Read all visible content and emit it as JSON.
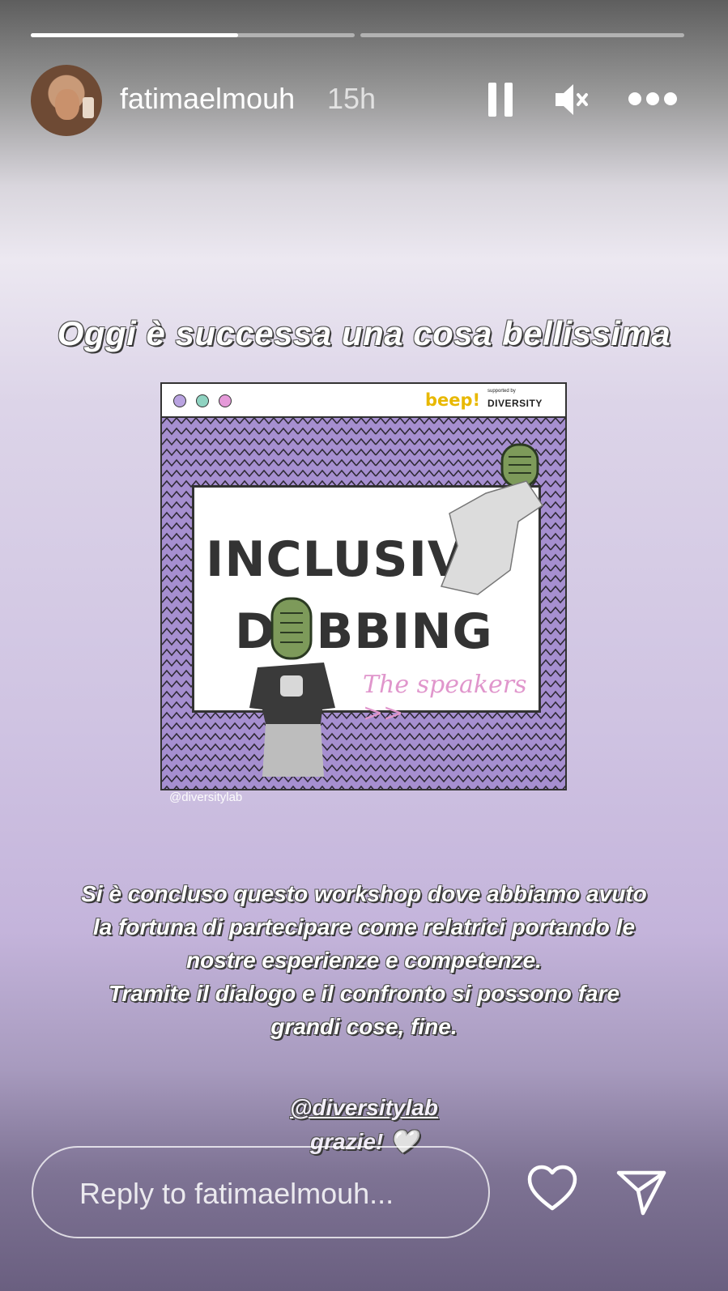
{
  "story": {
    "progress_segments": [
      {
        "fraction": 0.64
      },
      {
        "fraction": 0
      }
    ]
  },
  "header": {
    "username": "fatimaelmouh",
    "time": "15h",
    "icons": [
      "pause-icon",
      "mute-icon",
      "more-icon"
    ]
  },
  "content": {
    "headline": "Oggi è successa una cosa bellissima",
    "post": {
      "logo_beep": "beep!",
      "logo_supported": "supported by",
      "logo_diversity": "DIVERSITY",
      "title_line1": "INCLUSIVE",
      "title_line2": "DUBBING",
      "subtitle": "The speakers >>",
      "credit": "@diversitylab",
      "colors": {
        "background": "#a68fd0",
        "dot1": "#b9a3e0",
        "dot2": "#8fd3c1",
        "dot3": "#e59ad9"
      }
    },
    "body_lines": [
      "Si è concluso questo workshop dove abbiamo avuto",
      "la fortuna di partecipare come relatrici portando le",
      "nostre esperienze e competenze.",
      "Tramite il dialogo e il confronto si possono fare",
      "grandi cose, fine."
    ],
    "mention": "@diversitylab",
    "thanks": "grazie! 🤍"
  },
  "footer": {
    "reply_placeholder": "Reply to fatimaelmouh...",
    "icons": [
      "heart-icon",
      "send-icon"
    ]
  }
}
